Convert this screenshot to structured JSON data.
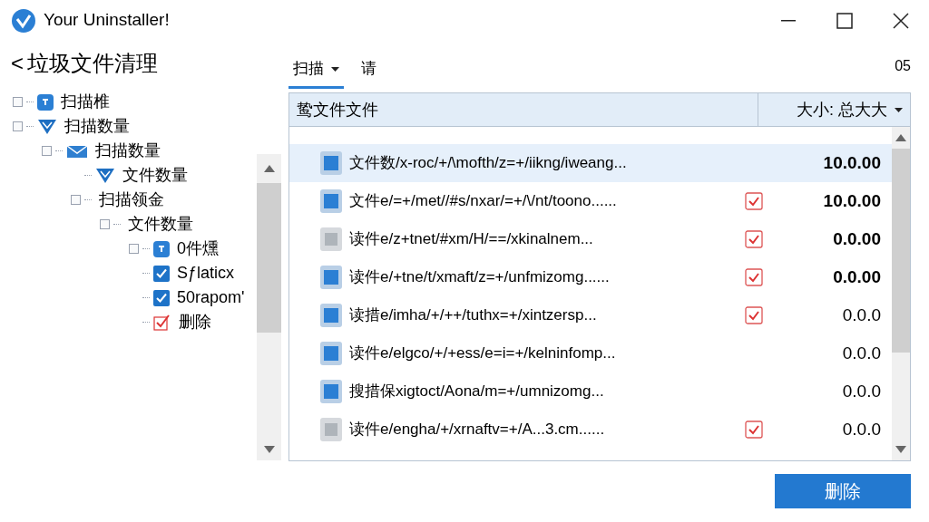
{
  "window": {
    "title": "Your Uninstaller!"
  },
  "page": {
    "back_icon": "<",
    "title": "垃圾文件清理"
  },
  "tree": [
    {
      "label": "扫描椎",
      "kind": "app",
      "expander": true
    },
    {
      "label": "扫描数量",
      "kind": "shield",
      "expander": true,
      "children": [
        {
          "label": "扫描数量",
          "kind": "mail",
          "expander": true,
          "children": [
            {
              "label": "文件数量",
              "kind": "shield",
              "expander": false
            },
            {
              "label": "扫描领金",
              "expander": true,
              "children": [
                {
                  "label": "文件数量",
                  "expander": true,
                  "children": [
                    {
                      "label": "0件燻",
                      "kind": "app",
                      "expander": true
                    },
                    {
                      "label": "Sƒlaticx",
                      "kind": "checkbox",
                      "checked": true,
                      "expander": false
                    },
                    {
                      "label": "50rapom'",
                      "kind": "checkbox",
                      "checked": true,
                      "expander": false
                    },
                    {
                      "label": "删除",
                      "kind": "redcheck",
                      "expander": false
                    }
                  ]
                }
              ]
            }
          ]
        }
      ]
    }
  ],
  "tabs": [
    {
      "label": "扫描",
      "dropdown": true,
      "selected": true
    },
    {
      "label": "请",
      "dropdown": false,
      "selected": false
    }
  ],
  "tab_count": "05",
  "list_header": {
    "name": "鸷文件文件",
    "sort": "大小: 总大大"
  },
  "rows": [
    {
      "kind": "folder",
      "name": "文件数/x-roc/+/\\mofth/z=+/iikng/iweang...",
      "checked": false,
      "selected": true,
      "size": "10.0.00"
    },
    {
      "kind": "folder",
      "name": "文件e/=+/met//#s/nxar/=+/\\/nt/toono......",
      "checked": true,
      "selected": false,
      "size": "10.0.00"
    },
    {
      "kind": "file",
      "name": "读件e/z+tnet/#xm/H/==/xkinalnem...",
      "checked": true,
      "selected": false,
      "size": "0.0.00"
    },
    {
      "kind": "folder",
      "name": "读件e/+tne/t/xmaft/z=+/unfmizomg......",
      "checked": true,
      "selected": false,
      "size": "0.0.00"
    },
    {
      "kind": "folder",
      "name": "读措e/imha/+/++/tuthx=+/xintzersp...",
      "checked": true,
      "selected": false,
      "size": "0.0.0"
    },
    {
      "kind": "folder",
      "name": "读件e/elgco/+/+ess/e=i=+/kelninfomp...",
      "checked": false,
      "selected": false,
      "size": "0.0.0"
    },
    {
      "kind": "folder",
      "name": "搜措保xigtoct/Aona/m=+/umnizomg...",
      "checked": false,
      "selected": false,
      "size": "0.0.0"
    },
    {
      "kind": "file",
      "name": "读件e/engha/+/xrnaftv=+/A...3.cm......",
      "checked": true,
      "selected": false,
      "size": "0.0.0"
    }
  ],
  "delete_button": "删除"
}
